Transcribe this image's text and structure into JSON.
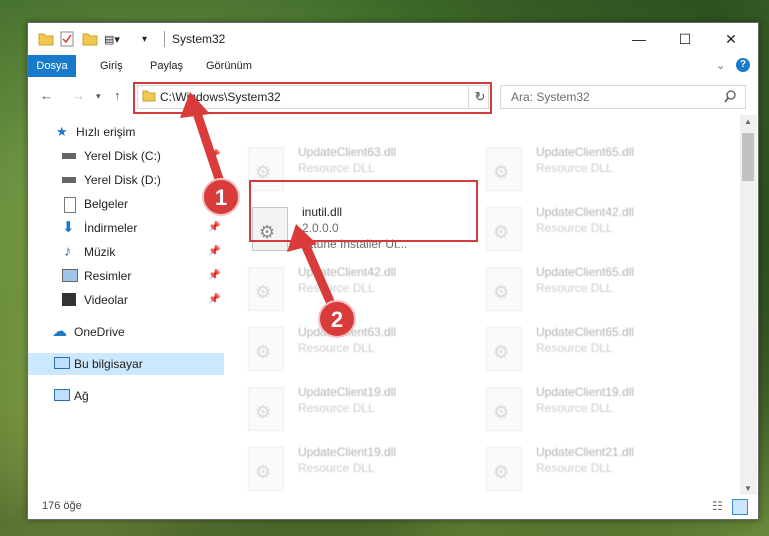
{
  "window": {
    "title": "System32"
  },
  "titlebar": {
    "minimize": "—",
    "maximize": "☐",
    "close": "✕"
  },
  "ribbon": {
    "tabs": [
      "Dosya",
      "Giriş",
      "Paylaş",
      "Görünüm"
    ]
  },
  "nav": {
    "address": "C:\\Windows\\System32",
    "search_placeholder": "Ara: System32"
  },
  "sidebar": {
    "items": [
      {
        "label": "Hızlı erişim",
        "icon": "star-icon"
      },
      {
        "label": "Yerel Disk (C:)",
        "icon": "drive-icon"
      },
      {
        "label": "Yerel Disk (D:)",
        "icon": "drive-icon"
      },
      {
        "label": "Belgeler",
        "icon": "document-icon"
      },
      {
        "label": "İndirmeler",
        "icon": "download-icon"
      },
      {
        "label": "Müzik",
        "icon": "music-icon"
      },
      {
        "label": "Resimler",
        "icon": "pictures-icon"
      },
      {
        "label": "Videolar",
        "icon": "video-icon"
      },
      {
        "label": "OneDrive",
        "icon": "cloud-icon"
      },
      {
        "label": "Bu bilgisayar",
        "icon": "computer-icon"
      },
      {
        "label": "Ağ",
        "icon": "network-icon"
      }
    ]
  },
  "files": [
    {
      "name": "UpdateClient63.dll",
      "sub": "Resource DLL"
    },
    {
      "name": "UpdateClient65.dll",
      "sub": "Resource DLL"
    },
    {
      "name": "inutil.dll",
      "sub": "2.0.0.0",
      "sub2": "Attune Installer Ut..."
    },
    {
      "name": "UpdateClient42.dll",
      "sub": "Resource DLL"
    },
    {
      "name": "UpdateClient42.dll",
      "sub": "Resource DLL"
    },
    {
      "name": "UpdateClient65.dll",
      "sub": "Resource DLL"
    },
    {
      "name": "UpdateClient63.dll",
      "sub": "Resource DLL"
    },
    {
      "name": "UpdateClient65.dll",
      "sub": "Resource DLL"
    },
    {
      "name": "UpdateClient19.dll",
      "sub": "Resource DLL"
    },
    {
      "name": "UpdateClient19.dll",
      "sub": "Resource DLL"
    },
    {
      "name": "UpdateClient19.dll",
      "sub": "Resource DLL"
    },
    {
      "name": "UpdateClient21.dll",
      "sub": "Resource DLL"
    }
  ],
  "status": {
    "count": "176 öğe"
  },
  "callouts": {
    "one": "1",
    "two": "2"
  },
  "colors": {
    "accent": "#1979ca",
    "highlight": "#d13b3b",
    "callout": "#d93a3a",
    "selection": "#cce8ff"
  }
}
